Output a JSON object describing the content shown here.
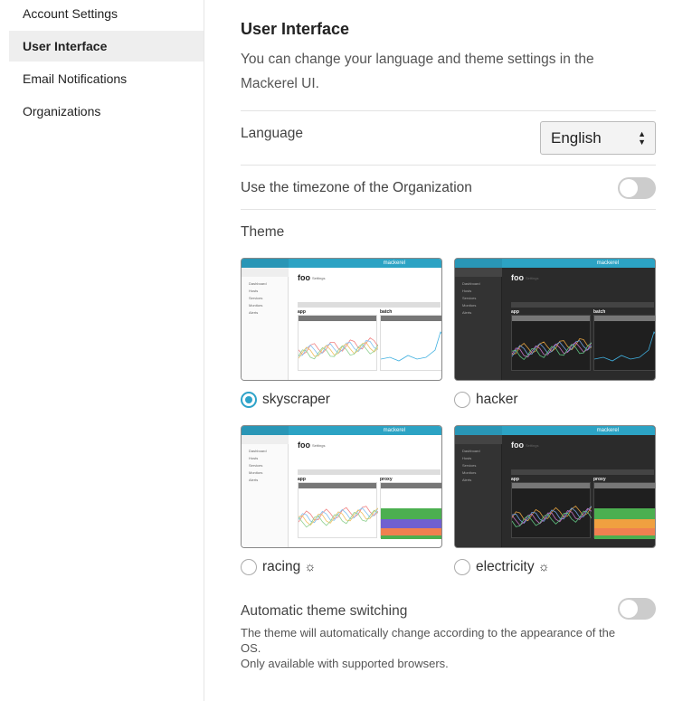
{
  "sidebar": {
    "items": [
      {
        "label": "Account Settings"
      },
      {
        "label": "User Interface",
        "active": true
      },
      {
        "label": "Email Notifications"
      },
      {
        "label": "Organizations"
      }
    ]
  },
  "main": {
    "title": "User Interface",
    "description": "You can change your language and theme settings in the Mackerel UI.",
    "language": {
      "label": "Language",
      "value": "English"
    },
    "timezone": {
      "label": "Use the timezone of the Organization",
      "enabled": false
    },
    "theme": {
      "label": "Theme",
      "selected": "skyscraper",
      "options": [
        {
          "name": "skyscraper",
          "dark": false,
          "auto_icon": false,
          "second_panel": "batch"
        },
        {
          "name": "hacker",
          "dark": true,
          "auto_icon": false,
          "second_panel": "batch"
        },
        {
          "name": "racing",
          "dark": false,
          "auto_icon": true,
          "second_panel": "proxy"
        },
        {
          "name": "electricity",
          "dark": true,
          "auto_icon": true,
          "second_panel": "proxy"
        }
      ]
    },
    "preview": {
      "brand": "mackerel",
      "host": "foo",
      "settings": "Settings",
      "panel1": "app",
      "nav": [
        "Dashboard",
        "Hosts",
        "Services",
        "Monitors",
        "Alerts"
      ]
    },
    "auto_switch": {
      "label": "Automatic theme switching",
      "enabled": false,
      "note1": "The theme will automatically change according to the appearance of the OS.",
      "note2": "Only available with supported browsers."
    }
  },
  "colors": {
    "accent": "#2ea3c9",
    "header": "#2ca3c4"
  }
}
